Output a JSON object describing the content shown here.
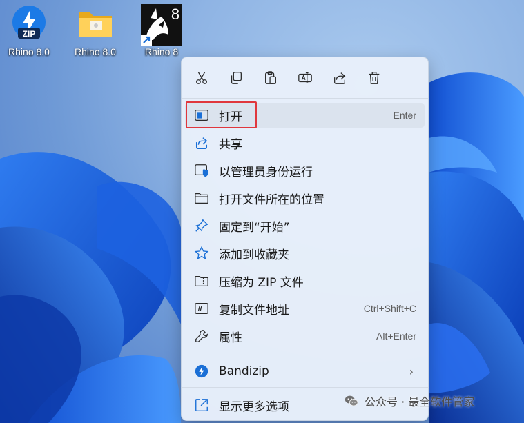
{
  "desktop": {
    "icons": [
      {
        "label": "Rhino 8.0",
        "icon": "bandizip-zip-icon",
        "badge": "ZIP"
      },
      {
        "label": "Rhino 8.0",
        "icon": "folder-icon"
      },
      {
        "label": "Rhino 8",
        "icon": "rhino-app-shortcut-icon",
        "badge": "8"
      }
    ]
  },
  "context_menu": {
    "toolbar": [
      {
        "action": "cut",
        "icon": "scissors-icon"
      },
      {
        "action": "copy",
        "icon": "copy-icon"
      },
      {
        "action": "paste",
        "icon": "paste-icon"
      },
      {
        "action": "rename",
        "icon": "rename-icon"
      },
      {
        "action": "share",
        "icon": "share-icon"
      },
      {
        "action": "delete",
        "icon": "trash-icon"
      }
    ],
    "items": [
      {
        "label": "打开",
        "shortcut": "Enter",
        "icon": "open-window-icon",
        "hover": true
      },
      {
        "label": "共享",
        "shortcut": "",
        "icon": "share-icon"
      },
      {
        "label": "以管理员身份运行",
        "shortcut": "",
        "icon": "shield-run-icon"
      },
      {
        "label": "打开文件所在的位置",
        "shortcut": "",
        "icon": "folder-outline-icon"
      },
      {
        "label": "固定到“开始”",
        "shortcut": "",
        "icon": "pin-icon"
      },
      {
        "label": "添加到收藏夹",
        "shortcut": "",
        "icon": "star-icon"
      },
      {
        "label": "压缩为 ZIP 文件",
        "shortcut": "",
        "icon": "zip-folder-icon"
      },
      {
        "label": "复制文件地址",
        "shortcut": "Ctrl+Shift+C",
        "icon": "copy-path-icon"
      },
      {
        "label": "属性",
        "shortcut": "Alt+Enter",
        "icon": "wrench-icon"
      }
    ],
    "bandizip": {
      "label": "Bandizip",
      "icon": "bandizip-icon",
      "submenu_indicator": "›"
    },
    "more": {
      "label": "显示更多选项",
      "icon": "more-options-icon"
    }
  },
  "watermark": {
    "text": "公众号 · 最全软件管家",
    "icon": "wechat-icon"
  },
  "colors": {
    "menu_bg": "#e8f0fa",
    "accent_blue": "#1a6fd6",
    "highlight_red": "#e0373d",
    "hover_bg": "#dbe3ee"
  }
}
